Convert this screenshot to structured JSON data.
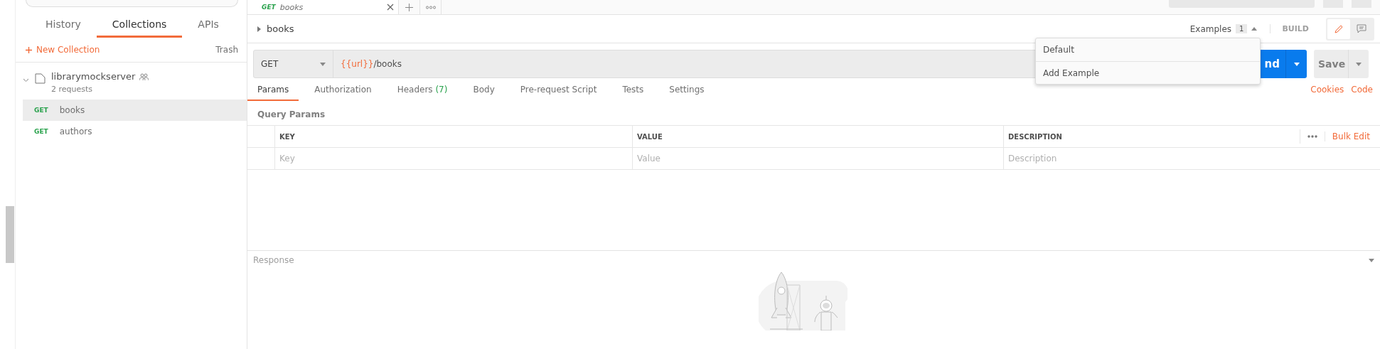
{
  "sidebar": {
    "tabs": [
      {
        "label": "History",
        "selected": false
      },
      {
        "label": "Collections",
        "selected": true
      },
      {
        "label": "APIs",
        "selected": false
      }
    ],
    "new_collection": "New Collection",
    "trash": "Trash",
    "collection": {
      "name": "librarymockserver",
      "count": "2 requests",
      "expanded": true,
      "requests": [
        {
          "method": "GET",
          "name": "books",
          "selected": true
        },
        {
          "method": "GET",
          "name": "authors",
          "selected": false
        }
      ]
    }
  },
  "request_tab": {
    "method": "GET",
    "name": "books"
  },
  "request": {
    "name": "books",
    "examples_label": "Examples",
    "examples_count": "1",
    "mode": "BUILD",
    "method": "GET",
    "url_variable": "{{url}}",
    "url_path": "/books",
    "send": "nd",
    "save": "Save"
  },
  "examples_menu": [
    "Default",
    "Add Example"
  ],
  "tabs": [
    {
      "label": "Params",
      "selected": true
    },
    {
      "label": "Authorization",
      "selected": false
    },
    {
      "label": "Headers",
      "count": "(7)",
      "selected": false
    },
    {
      "label": "Body",
      "selected": false
    },
    {
      "label": "Pre-request Script",
      "selected": false
    },
    {
      "label": "Tests",
      "selected": false
    },
    {
      "label": "Settings",
      "selected": false
    }
  ],
  "links": [
    "Cookies",
    "Code"
  ],
  "params": {
    "title": "Query Params",
    "columns": [
      "KEY",
      "VALUE",
      "DESCRIPTION"
    ],
    "bulk_edit": "Bulk Edit",
    "placeholders": [
      "Key",
      "Value",
      "Description"
    ]
  },
  "response": {
    "title": "Response"
  }
}
